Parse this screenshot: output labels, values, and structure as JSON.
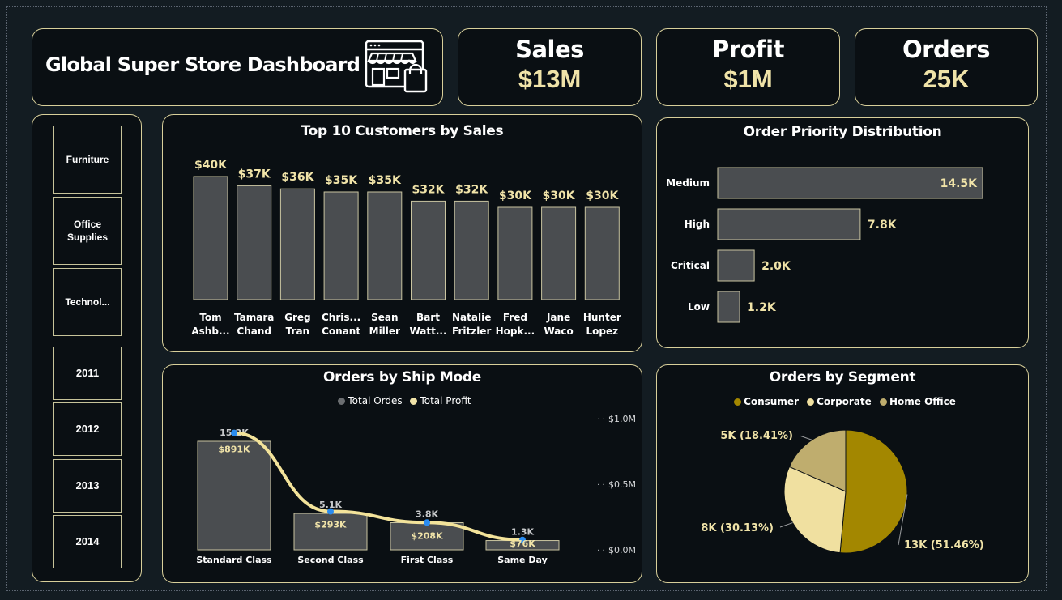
{
  "header": {
    "title": "Global Super Store Dashboard",
    "icon": "store-front-icon"
  },
  "kpis": [
    {
      "label": "Sales",
      "value": "$13M"
    },
    {
      "label": "Profit",
      "value": "$1M"
    },
    {
      "label": "Orders",
      "value": "25K"
    }
  ],
  "slicer": {
    "categories": [
      "Furniture",
      "Office Supplies",
      "Technol..."
    ],
    "years": [
      "2011",
      "2012",
      "2013",
      "2014"
    ]
  },
  "colors": {
    "background": "#131c22",
    "panel": "#0a0f13",
    "border": "#d8cf9a",
    "bar": "#4a4d50",
    "accent": "#f0e3a8",
    "profit_line": "#f3e39a",
    "point": "#2a8cf0",
    "consumer": "#a38700",
    "corporate": "#f0e0a0",
    "home_office": "#bfad6e"
  },
  "chart_data": [
    {
      "id": "top10",
      "type": "bar",
      "title": "Top 10 Customers by Sales",
      "categories": [
        "Tom Ashb...",
        "Tamara Chand",
        "Greg Tran",
        "Chris... Conant",
        "Sean Miller",
        "Bart Watt...",
        "Natalie Fritzler",
        "Fred Hopk...",
        "Jane Waco",
        "Hunter Lopez"
      ],
      "values": [
        40,
        37,
        36,
        35,
        35,
        32,
        32,
        30,
        30,
        30
      ],
      "labels": [
        "$40K",
        "$37K",
        "$36K",
        "$35K",
        "$35K",
        "$32K",
        "$32K",
        "$30K",
        "$30K",
        "$30K"
      ],
      "unit": "K",
      "ylim": [
        0,
        40
      ]
    },
    {
      "id": "priority",
      "type": "bar",
      "orientation": "horizontal",
      "title": "Order Priority Distribution",
      "categories": [
        "Medium",
        "High",
        "Critical",
        "Low"
      ],
      "values": [
        14.5,
        7.8,
        2.0,
        1.2
      ],
      "labels": [
        "14.5K",
        "7.8K",
        "2.0K",
        "1.2K"
      ],
      "xlim": [
        0,
        14.5
      ]
    },
    {
      "id": "shipmode",
      "type": "bar",
      "title": "Orders by Ship Mode",
      "categories": [
        "Standard Class",
        "Second Class",
        "First Class",
        "Same Day"
      ],
      "series": [
        {
          "name": "Total Ordes",
          "type": "bar",
          "values": [
            15.2,
            5.1,
            3.8,
            1.3
          ],
          "labels": [
            "15.2K",
            "5.1K",
            "3.8K",
            "1.3K"
          ]
        },
        {
          "name": "Total Profit",
          "type": "line",
          "values": [
            891,
            293,
            208,
            76
          ],
          "labels": [
            "$891K",
            "$293K",
            "$208K",
            "$76K"
          ]
        }
      ],
      "y2_ticks": [
        "$1.0M",
        "$0.5M",
        "$0.0M"
      ],
      "y2lim": [
        0,
        1000
      ],
      "ylim": [
        0,
        15.2
      ],
      "legend": "top-center"
    },
    {
      "id": "segment",
      "type": "pie",
      "title": "Orders by Segment",
      "categories": [
        "Consumer",
        "Corporate",
        "Home Office"
      ],
      "values": [
        51.46,
        30.13,
        18.41
      ],
      "labels": [
        "13K (51.46%)",
        "8K (30.13%)",
        "5K (18.41%)"
      ],
      "legend": "top-center"
    }
  ]
}
